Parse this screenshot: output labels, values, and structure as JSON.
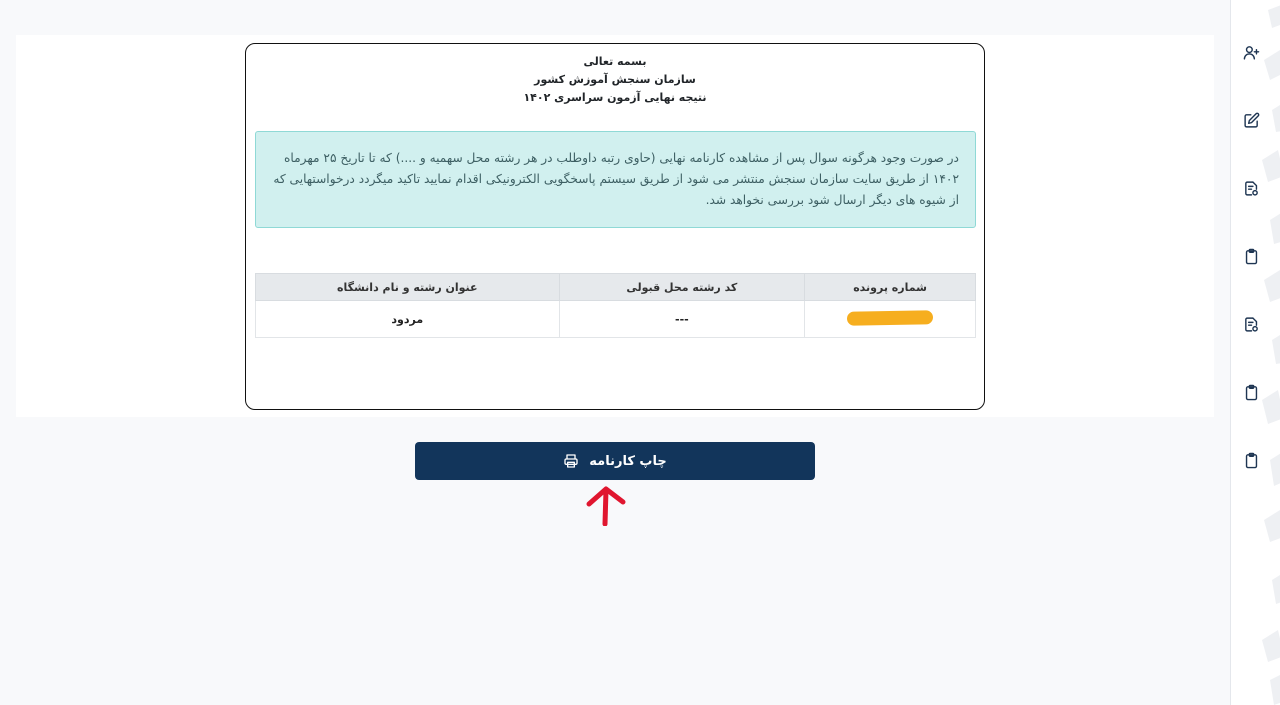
{
  "header": {
    "line1": "بسمه تعالی",
    "line2": "سازمان سنجش آموزش کشور",
    "line3": "نتیجه نهایی آزمون سراسری ۱۴۰۲"
  },
  "notice": {
    "text": "در صورت وجود هرگونه سوال پس از مشاهده کارنامه نهایی (حاوی رتبه داوطلب در هر رشته محل سهمیه و ....) که تا تاریخ ۲۵ مهرماه ۱۴۰۲ از طریق سایت سازمان سنجش منتشر می شود از طریق سیستم پاسخگویی الکترونیکی اقدام نمایید تاکید میگردد درخواستهایی که از شیوه های دیگر ارسال شود بررسی نخواهد شد."
  },
  "table": {
    "headers": [
      "شماره پرونده",
      "کد رشته محل قبولی",
      "عنوان رشته و نام دانشگاه"
    ],
    "row": {
      "file_number": "",
      "code": "---",
      "title": "مردود"
    }
  },
  "print_button": {
    "label": "چاپ کارنامه",
    "icon": "printer-icon"
  },
  "rail": {
    "icons": [
      "user-plus-icon",
      "edit-icon",
      "document-check-icon",
      "clipboard-icon",
      "document-check-icon",
      "clipboard-icon",
      "clipboard-icon"
    ]
  },
  "colors": {
    "button": "#12355b",
    "alert_bg": "#d1f0ef",
    "redaction": "#f6ae1f",
    "arrow": "#e0162f"
  }
}
